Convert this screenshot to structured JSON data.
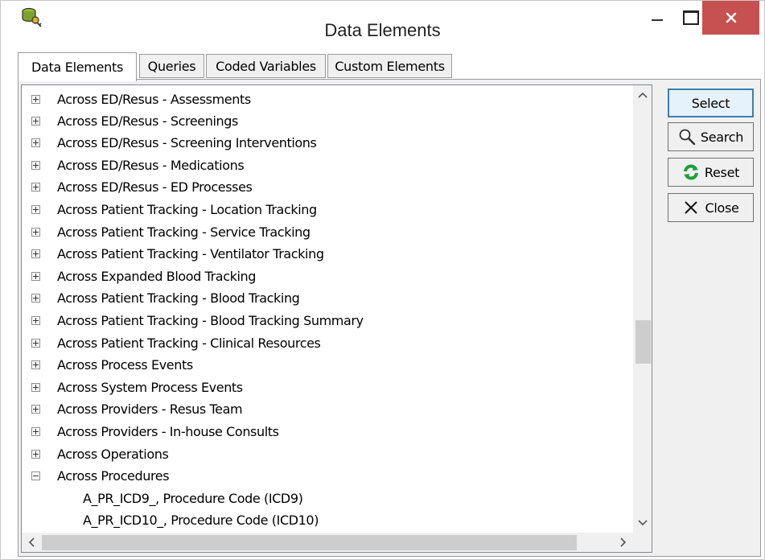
{
  "window": {
    "title": "Data Elements",
    "icon": "database-key-icon"
  },
  "tabs": [
    {
      "label": "Data Elements",
      "active": true
    },
    {
      "label": "Queries",
      "active": false
    },
    {
      "label": "Coded Variables",
      "active": false
    },
    {
      "label": "Custom Elements",
      "active": false
    }
  ],
  "tree": {
    "items": [
      {
        "label": "Across ED/Resus - Assessments",
        "expanded": false
      },
      {
        "label": "Across ED/Resus - Screenings",
        "expanded": false
      },
      {
        "label": "Across ED/Resus - Screening Interventions",
        "expanded": false
      },
      {
        "label": "Across ED/Resus - Medications",
        "expanded": false
      },
      {
        "label": "Across ED/Resus - ED Processes",
        "expanded": false
      },
      {
        "label": "Across Patient Tracking - Location Tracking",
        "expanded": false
      },
      {
        "label": "Across Patient Tracking - Service Tracking",
        "expanded": false
      },
      {
        "label": "Across Patient Tracking - Ventilator Tracking",
        "expanded": false
      },
      {
        "label": "Across Expanded Blood Tracking",
        "expanded": false
      },
      {
        "label": "Across Patient Tracking - Blood Tracking",
        "expanded": false
      },
      {
        "label": "Across Patient Tracking - Blood Tracking Summary",
        "expanded": false
      },
      {
        "label": "Across Patient Tracking - Clinical Resources",
        "expanded": false
      },
      {
        "label": "Across Process Events",
        "expanded": false
      },
      {
        "label": "Across System Process Events",
        "expanded": false
      },
      {
        "label": "Across Providers - Resus Team",
        "expanded": false
      },
      {
        "label": "Across Providers - In-house Consults",
        "expanded": false
      },
      {
        "label": "Across Operations",
        "expanded": false
      },
      {
        "label": "Across Procedures",
        "expanded": true
      }
    ],
    "children": [
      {
        "label": "A_PR_ICD9_, Procedure Code (ICD9)"
      },
      {
        "label": "A_PR_ICD10_, Procedure Code (ICD10)"
      }
    ]
  },
  "buttons": {
    "select": "Select",
    "search": "Search",
    "reset": "Reset",
    "close": "Close"
  },
  "colors": {
    "close_button_bg": "#c75050",
    "reset_icon": "#1e9e3a",
    "default_button_border": "#3c7fb1"
  }
}
